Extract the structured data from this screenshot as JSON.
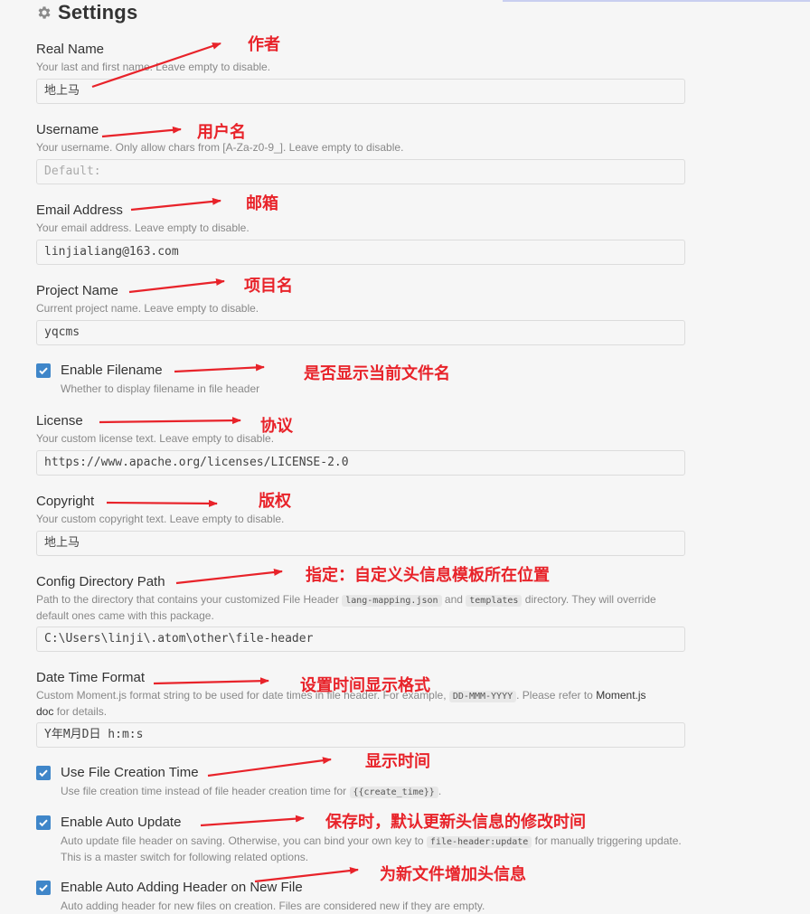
{
  "header": {
    "title": "Settings",
    "icon": "gear-icon"
  },
  "fields": {
    "real_name": {
      "label": "Real Name",
      "desc": "Your last and first name. Leave empty to disable.",
      "value": "地上马"
    },
    "username": {
      "label": "Username",
      "desc": "Your username. Only allow chars from [A-Za-z0-9_]. Leave empty to disable.",
      "placeholder": "Default:"
    },
    "email": {
      "label": "Email Address",
      "desc": "Your email address. Leave empty to disable.",
      "value": "linjialiang@163.com"
    },
    "project": {
      "label": "Project Name",
      "desc": "Current project name. Leave empty to disable.",
      "value": "yqcms"
    },
    "enable_filename": {
      "label": "Enable Filename",
      "desc": "Whether to display filename in file header",
      "checked": true
    },
    "license": {
      "label": "License",
      "desc": "Your custom license text. Leave empty to disable.",
      "value": "https://www.apache.org/licenses/LICENSE-2.0"
    },
    "copyright": {
      "label": "Copyright",
      "desc": "Your custom copyright text. Leave empty to disable.",
      "value": "地上马"
    },
    "config_dir": {
      "label": "Config Directory Path",
      "desc_a": "Path to the directory that contains your customized File Header",
      "code_a": "lang-mapping.json",
      "desc_b": "and",
      "code_b": "templates",
      "desc_c": "directory. They will override default ones came with this package.",
      "value": "C:\\Users\\linji\\.atom\\other\\file-header"
    },
    "datetime": {
      "label": "Date Time Format",
      "desc_a": "Custom Moment.js format string to be used for date times in file header. For example,",
      "code_a": "DD-MMM-YYYY",
      "desc_b": ". Please refer to",
      "link": "Moment.js doc",
      "desc_c": "for details.",
      "value": "Y年M月D日 h:m:s"
    },
    "use_creation": {
      "label": "Use File Creation Time",
      "desc_a": "Use file creation time instead of file header creation time for",
      "code_a": "{{create_time}}",
      "desc_b": ".",
      "checked": true
    },
    "auto_update": {
      "label": "Enable Auto Update",
      "desc_a": "Auto update file header on saving. Otherwise, you can bind your own key to",
      "code_a": "file-header:update",
      "desc_b": "for manually triggering update. This is a master switch for following related options.",
      "checked": true
    },
    "auto_adding": {
      "label": "Enable Auto Adding Header on New File",
      "desc": "Auto adding header for new files on creation. Files are considered new if they are empty.",
      "checked": true
    }
  },
  "annotations": {
    "real_name": "作者",
    "username": "用户名",
    "email": "邮箱",
    "project": "项目名",
    "enable_filename": "是否显示当前文件名",
    "license": "协议",
    "copyright": "版权",
    "config_dir": "指定：自定义头信息模板所在位置",
    "datetime": "设置时间显示格式",
    "use_creation": "显示时间",
    "auto_update": "保存时，默认更新头信息的修改时间",
    "auto_adding": "为新文件增加头信息"
  },
  "colors": {
    "annotation": "#e8232a",
    "checkbox": "#3f86c9",
    "label": "#333333",
    "description": "#888888"
  }
}
